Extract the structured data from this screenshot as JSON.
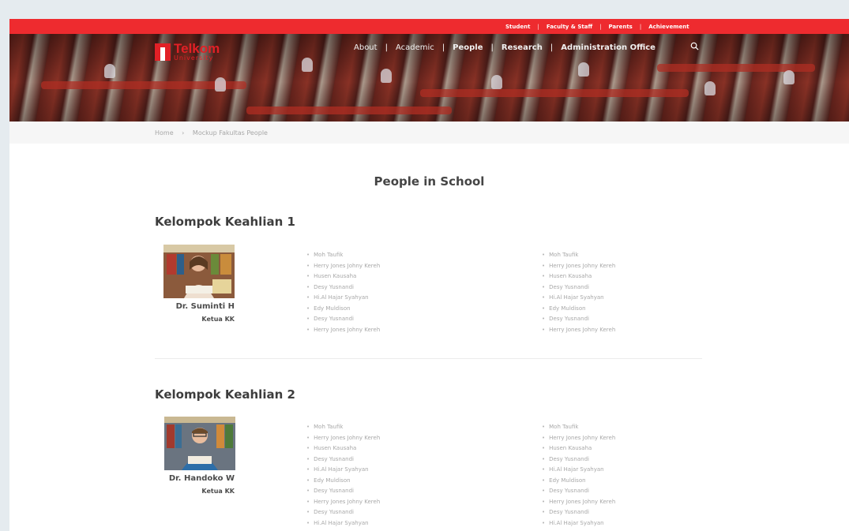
{
  "top_links": [
    "Student",
    "Faculty & Staff",
    "Parents",
    "Achievement"
  ],
  "logo": {
    "line1": "Telkom",
    "line2": "University"
  },
  "nav": [
    "About",
    "Academic",
    "People",
    "Research",
    "Administration Office"
  ],
  "breadcrumb": [
    "Home",
    "Mockup Fakultas People"
  ],
  "page_title": "People in School",
  "groups": [
    {
      "title": "Kelompok Keahlian 1",
      "person_name": "Dr. Suminti H",
      "person_role": "Ketua KK",
      "list_left": [
        "Moh Taufik",
        "Herry Jones Johny Kereh",
        "Husen Kausaha",
        "Desy Yusnandi",
        "Hi.Al Hajar Syahyan",
        "Edy Muldison",
        "Desy Yusnandi",
        "Herry Jones Johny Kereh"
      ],
      "list_right": [
        "Moh Taufik",
        "Herry Jones Johny Kereh",
        "Husen Kausaha",
        "Desy Yusnandi",
        "Hi.Al Hajar Syahyan",
        "Edy Muldison",
        "Desy Yusnandi",
        "Herry Jones Johny Kereh"
      ]
    },
    {
      "title": "Kelompok Keahlian 2",
      "person_name": "Dr. Handoko W",
      "person_role": "Ketua KK",
      "list_left": [
        "Moh Taufik",
        "Herry Jones Johny Kereh",
        "Husen Kausaha",
        "Desy Yusnandi",
        "Hi.Al Hajar Syahyan",
        "Edy Muldison",
        "Desy Yusnandi",
        "Herry Jones Johny Kereh",
        "Desy Yusnandi",
        "Hi.Al Hajar Syahyan"
      ],
      "list_right": [
        "Moh Taufik",
        "Herry Jones Johny Kereh",
        "Husen Kausaha",
        "Desy Yusnandi",
        "Hi.Al Hajar Syahyan",
        "Edy Muldison",
        "Desy Yusnandi",
        "Herry Jones Johny Kereh",
        "Desy Yusnandi",
        "Hi.Al Hajar Syahyan"
      ]
    }
  ],
  "colors": {
    "brand_red": "#ee2b2f",
    "text_dark": "#3d3d3d",
    "text_muted": "#a8a8a8"
  },
  "icons": {
    "search": "search-icon"
  }
}
